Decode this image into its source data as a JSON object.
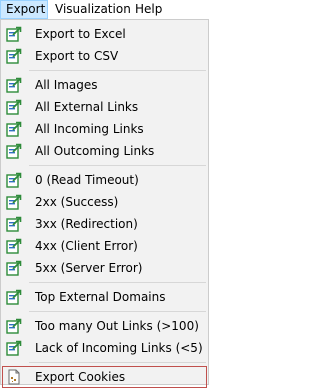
{
  "menubar": {
    "items": [
      {
        "label": "Export",
        "active": true
      },
      {
        "label": "Visualization",
        "active": false
      },
      {
        "label": "Help",
        "active": false
      }
    ]
  },
  "dropdown": {
    "groups": [
      [
        {
          "label": "Export to Excel",
          "icon": "export-icon"
        },
        {
          "label": "Export to CSV",
          "icon": "export-icon"
        }
      ],
      [
        {
          "label": "All Images",
          "icon": "export-icon"
        },
        {
          "label": "All External Links",
          "icon": "export-icon"
        },
        {
          "label": "All Incoming Links",
          "icon": "export-icon"
        },
        {
          "label": "All Outcoming Links",
          "icon": "export-icon"
        }
      ],
      [
        {
          "label": "0 (Read Timeout)",
          "icon": "export-icon"
        },
        {
          "label": "2xx (Success)",
          "icon": "export-icon"
        },
        {
          "label": "3xx (Redirection)",
          "icon": "export-icon"
        },
        {
          "label": "4xx (Client Error)",
          "icon": "export-icon"
        },
        {
          "label": "5xx (Server Error)",
          "icon": "export-icon"
        }
      ],
      [
        {
          "label": "Top External Domains",
          "icon": "export-icon"
        }
      ],
      [
        {
          "label": "Too many Out Links (>100)",
          "icon": "export-icon"
        },
        {
          "label": "Lack of Incoming Links (<5)",
          "icon": "export-icon"
        }
      ],
      [
        {
          "label": "Export Cookies",
          "icon": "cookie-file-icon",
          "highlighted": true
        }
      ]
    ]
  },
  "colors": {
    "icon_green": "#2e8b3a",
    "icon_blue": "#2f6fc6",
    "highlight_border": "#c0504d",
    "menu_active_bg": "#cce8ff"
  }
}
